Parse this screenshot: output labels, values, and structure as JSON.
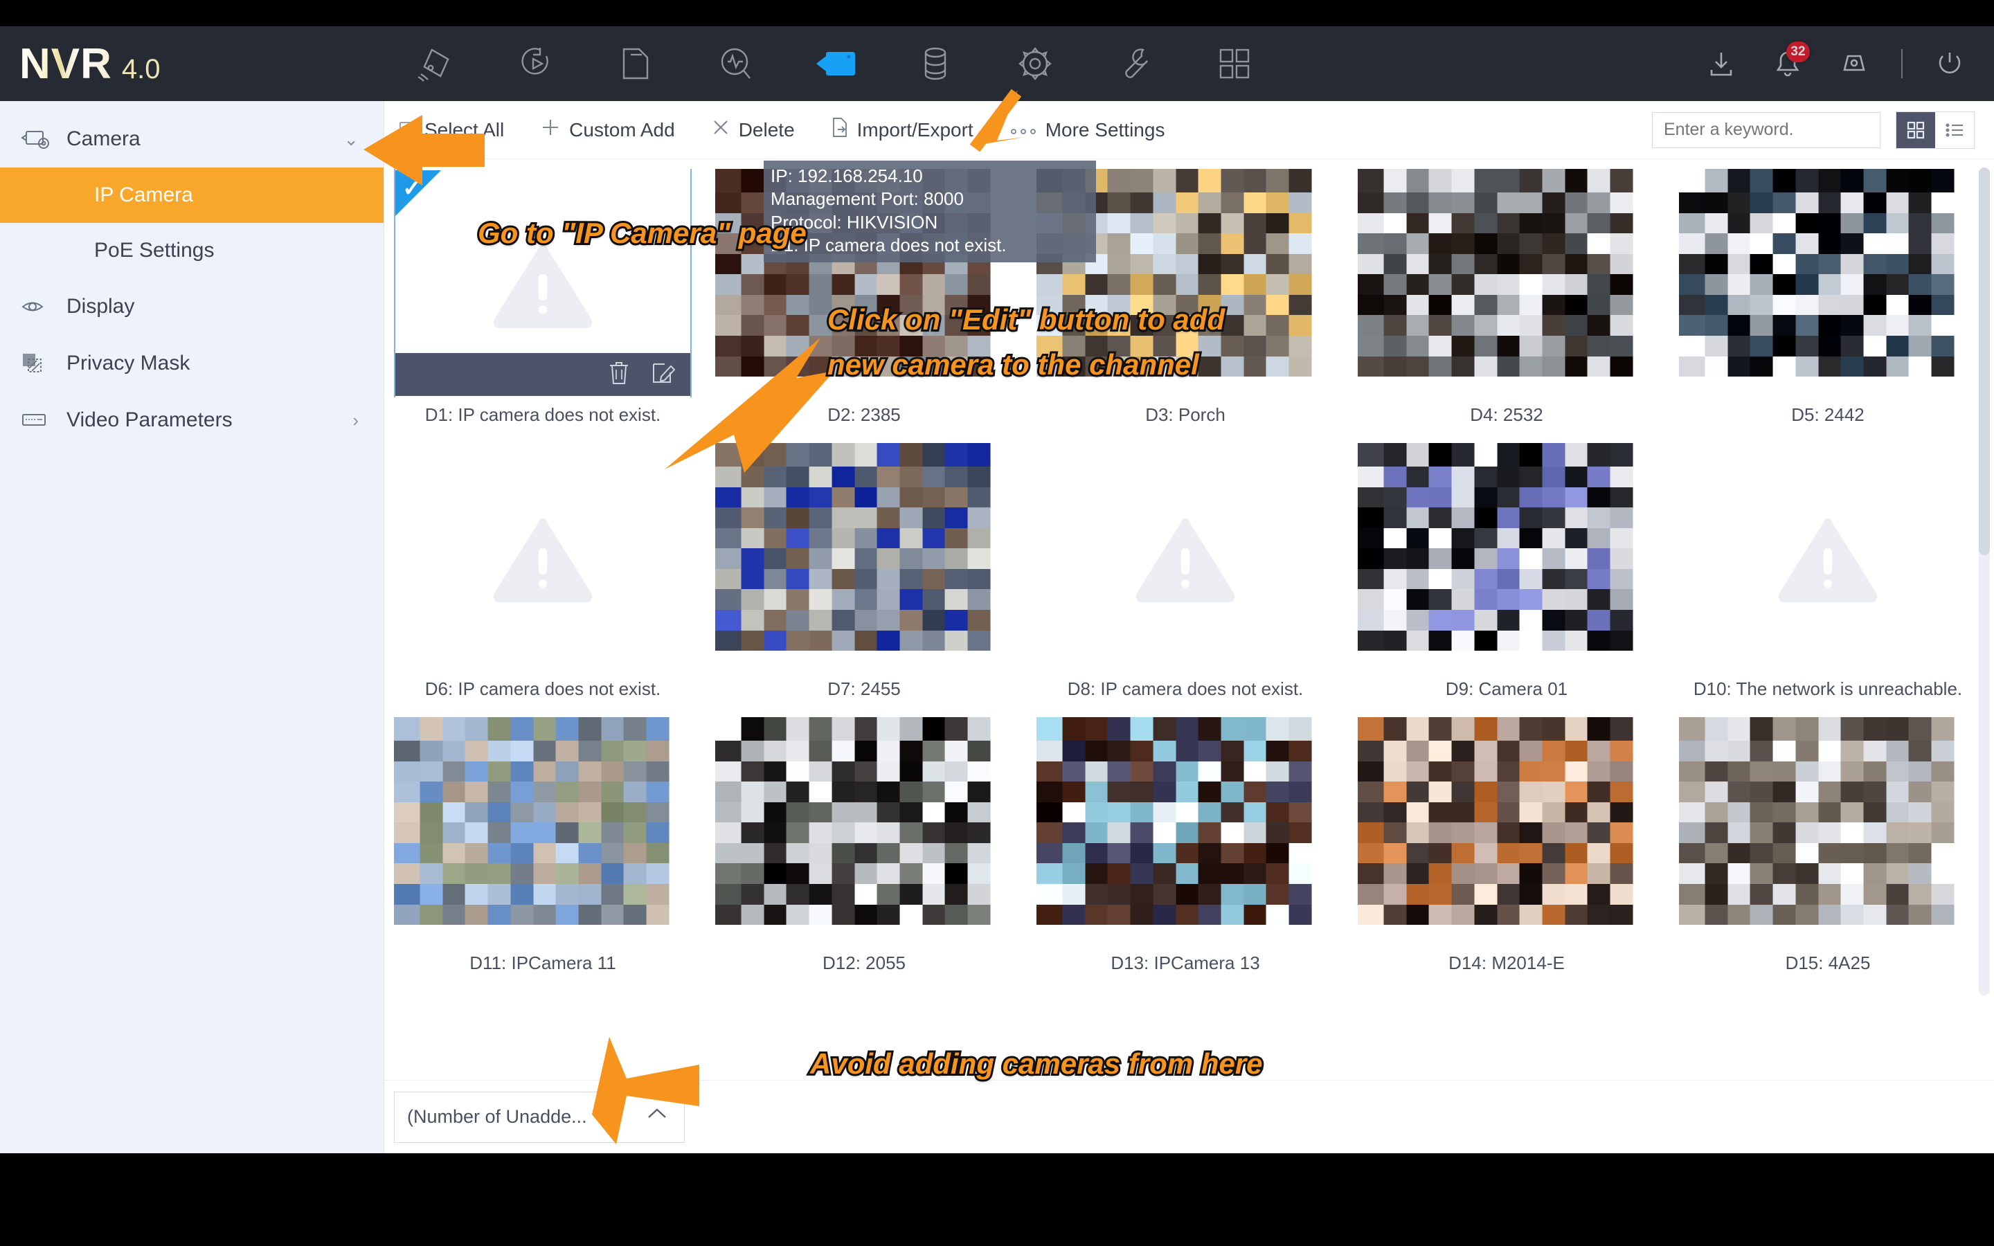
{
  "app": {
    "logo_main": "NVR",
    "logo_version": "4.0"
  },
  "header": {
    "nav_icons": [
      {
        "name": "live-view-icon",
        "label": "Live View"
      },
      {
        "name": "playback-icon",
        "label": "Playback"
      },
      {
        "name": "file-management-icon",
        "label": "File Management"
      },
      {
        "name": "smart-analysis-icon",
        "label": "Smart Analysis"
      },
      {
        "name": "camera-icon",
        "label": "Camera",
        "active": true
      },
      {
        "name": "storage-icon",
        "label": "Storage"
      },
      {
        "name": "system-icon",
        "label": "System"
      },
      {
        "name": "maintenance-icon",
        "label": "Maintenance"
      },
      {
        "name": "app-grid-icon",
        "label": "Applications"
      }
    ],
    "right_icons": [
      {
        "name": "download-icon",
        "label": "Download"
      },
      {
        "name": "alarm-bell-icon",
        "label": "Alarms",
        "badge": "32"
      },
      {
        "name": "alarm-lamp-icon",
        "label": "Alarm Output"
      },
      {
        "name": "power-icon",
        "label": "Shutdown"
      }
    ]
  },
  "sidebar": {
    "items": [
      {
        "label": "Camera",
        "icon": "camera-config-icon",
        "chevron": "⌄",
        "type": "group"
      },
      {
        "label": "IP Camera",
        "type": "sub",
        "selected": true
      },
      {
        "label": "PoE Settings",
        "type": "sub",
        "selected": false
      },
      {
        "label": "Display",
        "icon": "eye-icon",
        "type": "item"
      },
      {
        "label": "Privacy Mask",
        "icon": "privacy-mask-icon",
        "type": "item"
      },
      {
        "label": "Video Parameters",
        "icon": "video-parameters-icon",
        "chevron": "›",
        "type": "item"
      }
    ]
  },
  "toolbar": {
    "select_all": "Select All",
    "custom_add": "Custom Add",
    "delete": "Delete",
    "import_export": "Import/Export",
    "more_settings": "More Settings",
    "search_placeholder": "Enter a keyword.",
    "view_grid": "grid-view-icon",
    "view_list": "list-view-icon"
  },
  "tooltip": {
    "line1": "IP: 192.168.254.10",
    "line2": "Management Port: 8000",
    "line3": "Protocol: HIKVISION",
    "line4": "D1: IP camera does not exist."
  },
  "cameras": [
    {
      "id": "D1",
      "caption": "D1: IP camera does not exist.",
      "state": "empty",
      "selected": true
    },
    {
      "id": "D2",
      "caption": "D2: 2385",
      "state": "online",
      "thumb": "t2"
    },
    {
      "id": "D3",
      "caption": "D3: Porch",
      "state": "online",
      "thumb": "t3"
    },
    {
      "id": "D4",
      "caption": "D4: 2532",
      "state": "online",
      "thumb": "t4"
    },
    {
      "id": "D5",
      "caption": "D5: 2442",
      "state": "online",
      "thumb": "t5"
    },
    {
      "id": "D6",
      "caption": "D6: IP camera does not exist.",
      "state": "empty"
    },
    {
      "id": "D7",
      "caption": "D7: 2455",
      "state": "online",
      "thumb": "t7"
    },
    {
      "id": "D8",
      "caption": "D8: IP camera does not exist.",
      "state": "empty"
    },
    {
      "id": "D9",
      "caption": "D9: Camera 01",
      "state": "online",
      "thumb": "t9"
    },
    {
      "id": "D10",
      "caption": "D10: The network is unreachable.",
      "state": "empty"
    },
    {
      "id": "D11",
      "caption": "D11: IPCamera 11",
      "state": "online",
      "thumb": "t11"
    },
    {
      "id": "D12",
      "caption": "D12: 2055",
      "state": "online",
      "thumb": "t12"
    },
    {
      "id": "D13",
      "caption": "D13: IPCamera 13",
      "state": "online",
      "thumb": "t13"
    },
    {
      "id": "D14",
      "caption": "D14: M2014-E",
      "state": "online",
      "thumb": "t14"
    },
    {
      "id": "D15",
      "caption": "D15: 4A25",
      "state": "online",
      "thumb": "t15"
    }
  ],
  "card_actions": {
    "delete": "trash-icon",
    "edit": "edit-icon"
  },
  "bottom": {
    "unadded_label": "(Number of Unadde...",
    "collapse_icon": "chevron-up-icon"
  },
  "annotations": [
    {
      "name": "annotation-go-to-ip-camera",
      "text": "Go to \"IP Camera\" page"
    },
    {
      "name": "annotation-click-edit-line1",
      "text": "Click on \"Edit\" button to add"
    },
    {
      "name": "annotation-click-edit-line2",
      "text": "new camera to the channel"
    },
    {
      "name": "annotation-avoid-adding",
      "text": "Avoid adding cameras from here"
    }
  ],
  "colors": {
    "accent_orange": "#f9a72b",
    "annotation_orange": "#f7941e",
    "header_bg": "#262a33",
    "sidebar_bg": "#eef2fa",
    "selection_blue": "#1f9ae8",
    "badge_red": "#e8192c"
  }
}
